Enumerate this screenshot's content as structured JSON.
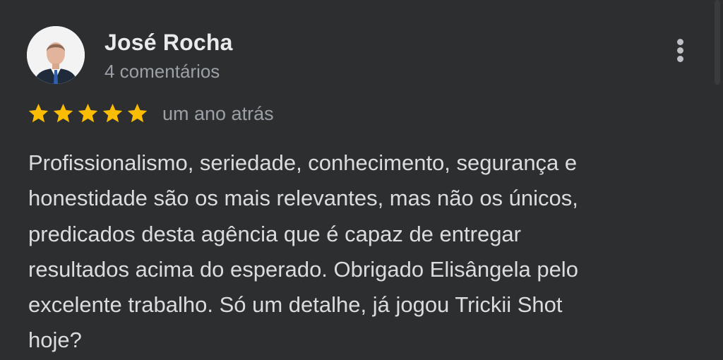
{
  "review": {
    "author_name": "José Rocha",
    "comment_count": "4 comentários",
    "rating": 5,
    "max_rating": 5,
    "time": "um ano atrás",
    "text": "Profissionalismo, seriedade, conhecimento, segurança e\nhonestidade são os mais relevantes, mas não os únicos,\npredicados desta agência que é capaz de entregar\nresultados acima do esperado. Obrigado Elisângela pelo\nexcelente trabalho. Só um detalhe, já jogou Trickii Shot\nhoje?"
  },
  "icons": {
    "menu": "more-vert-icon",
    "star": "star-icon"
  },
  "colors": {
    "background": "#2d2e30",
    "star": "#fbbc04",
    "primary_text": "#e8eaed",
    "secondary_text": "#9aa0a6"
  }
}
